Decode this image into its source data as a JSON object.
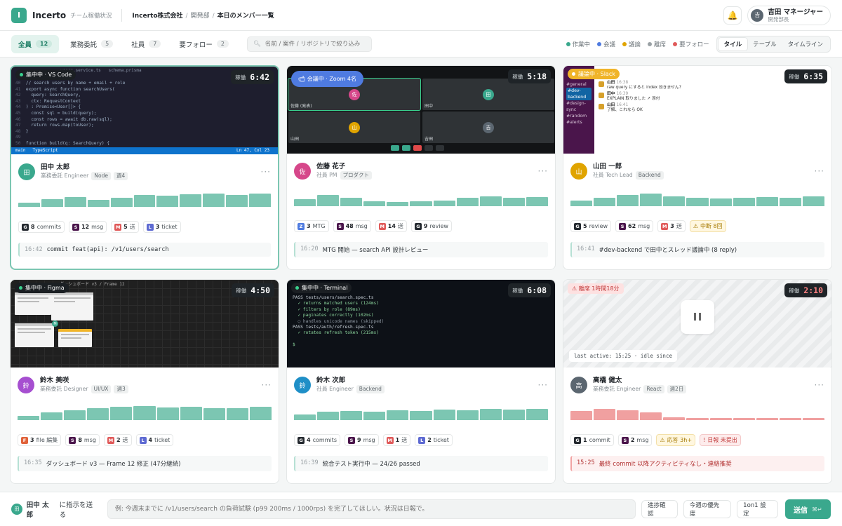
{
  "app": {
    "logo_letter": "I",
    "name": "Incerto",
    "subtitle": "チーム稼働状況"
  },
  "breadcrumb": {
    "company": "Incerto株式会社",
    "dept": "開発部",
    "page": "本日のメンバー一覧"
  },
  "user": {
    "avatar": "吉",
    "name": "吉田 マネージャー",
    "role": "開発部長"
  },
  "filters": [
    {
      "label": "全員",
      "count": "12"
    },
    {
      "label": "業務委託",
      "count": "5"
    },
    {
      "label": "社員",
      "count": "7"
    },
    {
      "label": "要フォロー",
      "count": "2"
    }
  ],
  "search": {
    "placeholder": "名前 / 案件 / リポジトリで絞り込み"
  },
  "legend": [
    {
      "label": "作業中",
      "color": "#3aa88d"
    },
    {
      "label": "会議",
      "color": "#4f7be0"
    },
    {
      "label": "議論",
      "color": "#e0a400"
    },
    {
      "label": "離席",
      "color": "#9aa1a5"
    },
    {
      "label": "要フォロー",
      "color": "#e05a5a"
    }
  ],
  "views": [
    "タイル",
    "テーブル",
    "タイムライン"
  ],
  "cards": [
    {
      "status": "集中中 · VS Code",
      "timer_label": "稼働",
      "timer": "6:42",
      "avatar": "田",
      "avatar_color": "#3aa88d",
      "name": "田中 太郎",
      "role": "業務委託 Engineer",
      "tags": [
        "Node",
        "週4"
      ],
      "activity_levels": [
        0.25,
        0.45,
        0.6,
        0.4,
        0.55,
        0.7,
        0.65,
        0.75,
        0.8,
        0.7,
        0.78
      ],
      "bar_color": "#7cc6b2",
      "stats": [
        {
          "icon": "G",
          "color": "#24292f",
          "value": "8",
          "label": "commits"
        },
        {
          "icon": "S",
          "color": "#4a154b",
          "value": "12",
          "label": "msg"
        },
        {
          "icon": "M",
          "color": "#e05a5a",
          "value": "5",
          "label": "送"
        },
        {
          "icon": "L",
          "color": "#5e6ad2",
          "value": "3",
          "label": "ticket"
        }
      ],
      "activity_time": "16:42",
      "activity_text": "commit feat(api): /v1/users/search",
      "shot": {
        "tabs": "users.service.ts   schema.prisma",
        "code": [
          "// search users by name + email + role",
          "export async function searchUsers(",
          "  query: SearchQuery,",
          "  ctx: RequestContext",
          ") : Promise<User[]> {",
          "  const sql = build(query);",
          "  const rows = await db.raw(sql);",
          "  return rows.map(toUser);",
          "}",
          "",
          "function build(q: SearchQuery) {"
        ],
        "status_left": "main",
        "status_lang": "TypeScript",
        "status_pos": "Ln 47, Col 23"
      }
    },
    {
      "status": "会議中 · Zoom 4名",
      "timer_label": "稼働",
      "timer": "5:18",
      "avatar": "佐",
      "avatar_color": "#d6478a",
      "name": "佐藤 花子",
      "role": "社員 PM",
      "tags": [
        "プロダクト"
      ],
      "activity_levels": [
        0.4,
        0.65,
        0.5,
        0.3,
        0.25,
        0.3,
        0.35,
        0.5,
        0.6,
        0.5,
        0.55
      ],
      "bar_color": "#7cc6b2",
      "stats": [
        {
          "icon": "Z",
          "color": "#4f7be0",
          "value": "3",
          "label": "MTG"
        },
        {
          "icon": "S",
          "color": "#4a154b",
          "value": "48",
          "label": "msg"
        },
        {
          "icon": "M",
          "color": "#e05a5a",
          "value": "14",
          "label": "送"
        },
        {
          "icon": "G",
          "color": "#24292f",
          "value": "9",
          "label": "review"
        }
      ],
      "activity_time": "16:20",
      "activity_text": "MTG 開始 — search API 設計レビュー",
      "shot": {
        "tiles": [
          {
            "name": "佐藤 (発表)",
            "a": "佐",
            "c": "#d6478a"
          },
          {
            "name": "田中",
            "a": "田",
            "c": "#3aa88d"
          },
          {
            "name": "山田",
            "a": "山",
            "c": "#e0a400"
          },
          {
            "name": "吉田",
            "a": "吉",
            "c": "#5b6670"
          }
        ]
      }
    },
    {
      "status": "議論中 · Slack",
      "timer_label": "稼働",
      "timer": "6:35",
      "avatar": "山",
      "avatar_color": "#e0a400",
      "name": "山田 一郎",
      "role": "社員 Tech Lead",
      "tags": [
        "Backend"
      ],
      "activity_levels": [
        0.35,
        0.5,
        0.65,
        0.75,
        0.6,
        0.5,
        0.45,
        0.5,
        0.55,
        0.5,
        0.6
      ],
      "bar_color": "#7cc6b2",
      "stats": [
        {
          "icon": "G",
          "color": "#24292f",
          "value": "5",
          "label": "review"
        },
        {
          "icon": "S",
          "color": "#4a154b",
          "value": "62",
          "label": "msg"
        },
        {
          "icon": "M",
          "color": "#e05a5a",
          "value": "3",
          "label": "送"
        },
        {
          "icon": "⚠",
          "warn": true,
          "value": "",
          "label": "中断 8回"
        }
      ],
      "activity_time": "16:41",
      "activity_text": "#dev-backend で田中とスレッド議論中 (8 reply)",
      "shot": {
        "channels": [
          "#general",
          "#dev-backend",
          "#design-sync",
          "#random",
          "#alerts"
        ],
        "messages": [
          {
            "user": "山田",
            "time": "16:38",
            "text": "raw query にすると index 効きません?"
          },
          {
            "user": "田中",
            "time": "16:39",
            "text": "EXPLAIN 取りました ↗ 添付"
          },
          {
            "user": "山田",
            "time": "16:41",
            "text": "了解、これなら OK"
          }
        ]
      }
    },
    {
      "status": "集中中 · Figma",
      "timer_label": "稼働",
      "timer": "4:50",
      "avatar": "鈴",
      "avatar_color": "#a64fd0",
      "name": "鈴木 美咲",
      "role": "業務委託 Designer",
      "tags": [
        "UI/UX",
        "週3"
      ],
      "activity_levels": [
        0.25,
        0.45,
        0.6,
        0.7,
        0.8,
        0.85,
        0.75,
        0.8,
        0.7,
        0.72,
        0.78
      ],
      "bar_color": "#7cc6b2",
      "stats": [
        {
          "icon": "F",
          "color": "#e0623a",
          "value": "3",
          "label": "file 編集"
        },
        {
          "icon": "S",
          "color": "#4a154b",
          "value": "8",
          "label": "msg"
        },
        {
          "icon": "M",
          "color": "#e05a5a",
          "value": "2",
          "label": "送"
        },
        {
          "icon": "L",
          "color": "#5e6ad2",
          "value": "4",
          "label": "ticket"
        }
      ],
      "activity_time": "16:35",
      "activity_text": "ダッシュボード v3 — Frame 12 修正 (47分継続)",
      "shot": {
        "title": "ダッシュボード v3 / Frame 12"
      }
    },
    {
      "status": "集中中 · Terminal",
      "timer_label": "稼働",
      "timer": "6:08",
      "avatar": "鈴",
      "avatar_color": "#1f8fc7",
      "name": "鈴木 次郎",
      "role": "社員 Engineer",
      "tags": [
        "Backend"
      ],
      "activity_levels": [
        0.35,
        0.5,
        0.55,
        0.5,
        0.6,
        0.55,
        0.62,
        0.6,
        0.65,
        0.62,
        0.68
      ],
      "bar_color": "#7cc6b2",
      "stats": [
        {
          "icon": "G",
          "color": "#24292f",
          "value": "4",
          "label": "commits"
        },
        {
          "icon": "S",
          "color": "#4a154b",
          "value": "9",
          "label": "msg"
        },
        {
          "icon": "M",
          "color": "#e05a5a",
          "value": "1",
          "label": "送"
        },
        {
          "icon": "L",
          "color": "#5e6ad2",
          "value": "2",
          "label": "ticket"
        }
      ],
      "activity_time": "16:39",
      "activity_text": "統合テスト実行中 — 24/26 passed",
      "shot": {
        "lines": [
          {
            "cls": "w",
            "t": "PASS tests/users/search.spec.ts"
          },
          {
            "cls": "",
            "t": "  ✓ returns matched users (124ms)"
          },
          {
            "cls": "",
            "t": "  ✓ filters by role (89ms)"
          },
          {
            "cls": "",
            "t": "  ✓ paginates correctly (102ms)"
          },
          {
            "cls": "d",
            "t": "  ○ handles unicode names (skipped)"
          },
          {
            "cls": "w",
            "t": "PASS tests/auth/refresh.spec.ts"
          },
          {
            "cls": "",
            "t": "  ✓ rotates refresh token (215ms)"
          },
          {
            "cls": "",
            "t": ""
          },
          {
            "cls": "",
            "t": "$ "
          }
        ]
      }
    },
    {
      "status": "離席 1時間18分",
      "timer_label": "稼働",
      "timer": "2:10",
      "avatar": "高",
      "avatar_color": "#5b6670",
      "name": "高橋 健太",
      "role": "業務委託 Engineer",
      "tags": [
        "React",
        "週2日"
      ],
      "activity_levels": [
        0.55,
        0.65,
        0.6,
        0.45,
        0.15,
        0.12,
        0.12,
        0.12,
        0.12,
        0.12,
        0.12
      ],
      "bar_color": "#f0a0a0",
      "stats": [
        {
          "icon": "G",
          "color": "#24292f",
          "value": "1",
          "label": "commit"
        },
        {
          "icon": "S",
          "color": "#4a154b",
          "value": "2",
          "label": "msg"
        },
        {
          "icon": "⚠",
          "warn": true,
          "value": "",
          "label": "応答 3h+"
        },
        {
          "icon": "!",
          "err": true,
          "value": "",
          "label": "日報 未提出"
        }
      ],
      "activity_time": "15:25",
      "activity_text": "最終 commit 以降アクティビティなし・連絡推奨",
      "shot": {
        "note": "last active: 15:25 · idle since"
      }
    }
  ],
  "command": {
    "target_avatar": "田",
    "target_name": "田中 太郎",
    "target_suffix": "に指示を送る",
    "placeholder": "例: 今週末までに /v1/users/search の負荷試験 (p99 200ms / 1000rps) を完了してほしい。状況は日報で。",
    "quick": [
      "進捗確認",
      "今週の優先度",
      "1on1 設定"
    ],
    "send": "送信",
    "send_key": "⌘↵"
  }
}
